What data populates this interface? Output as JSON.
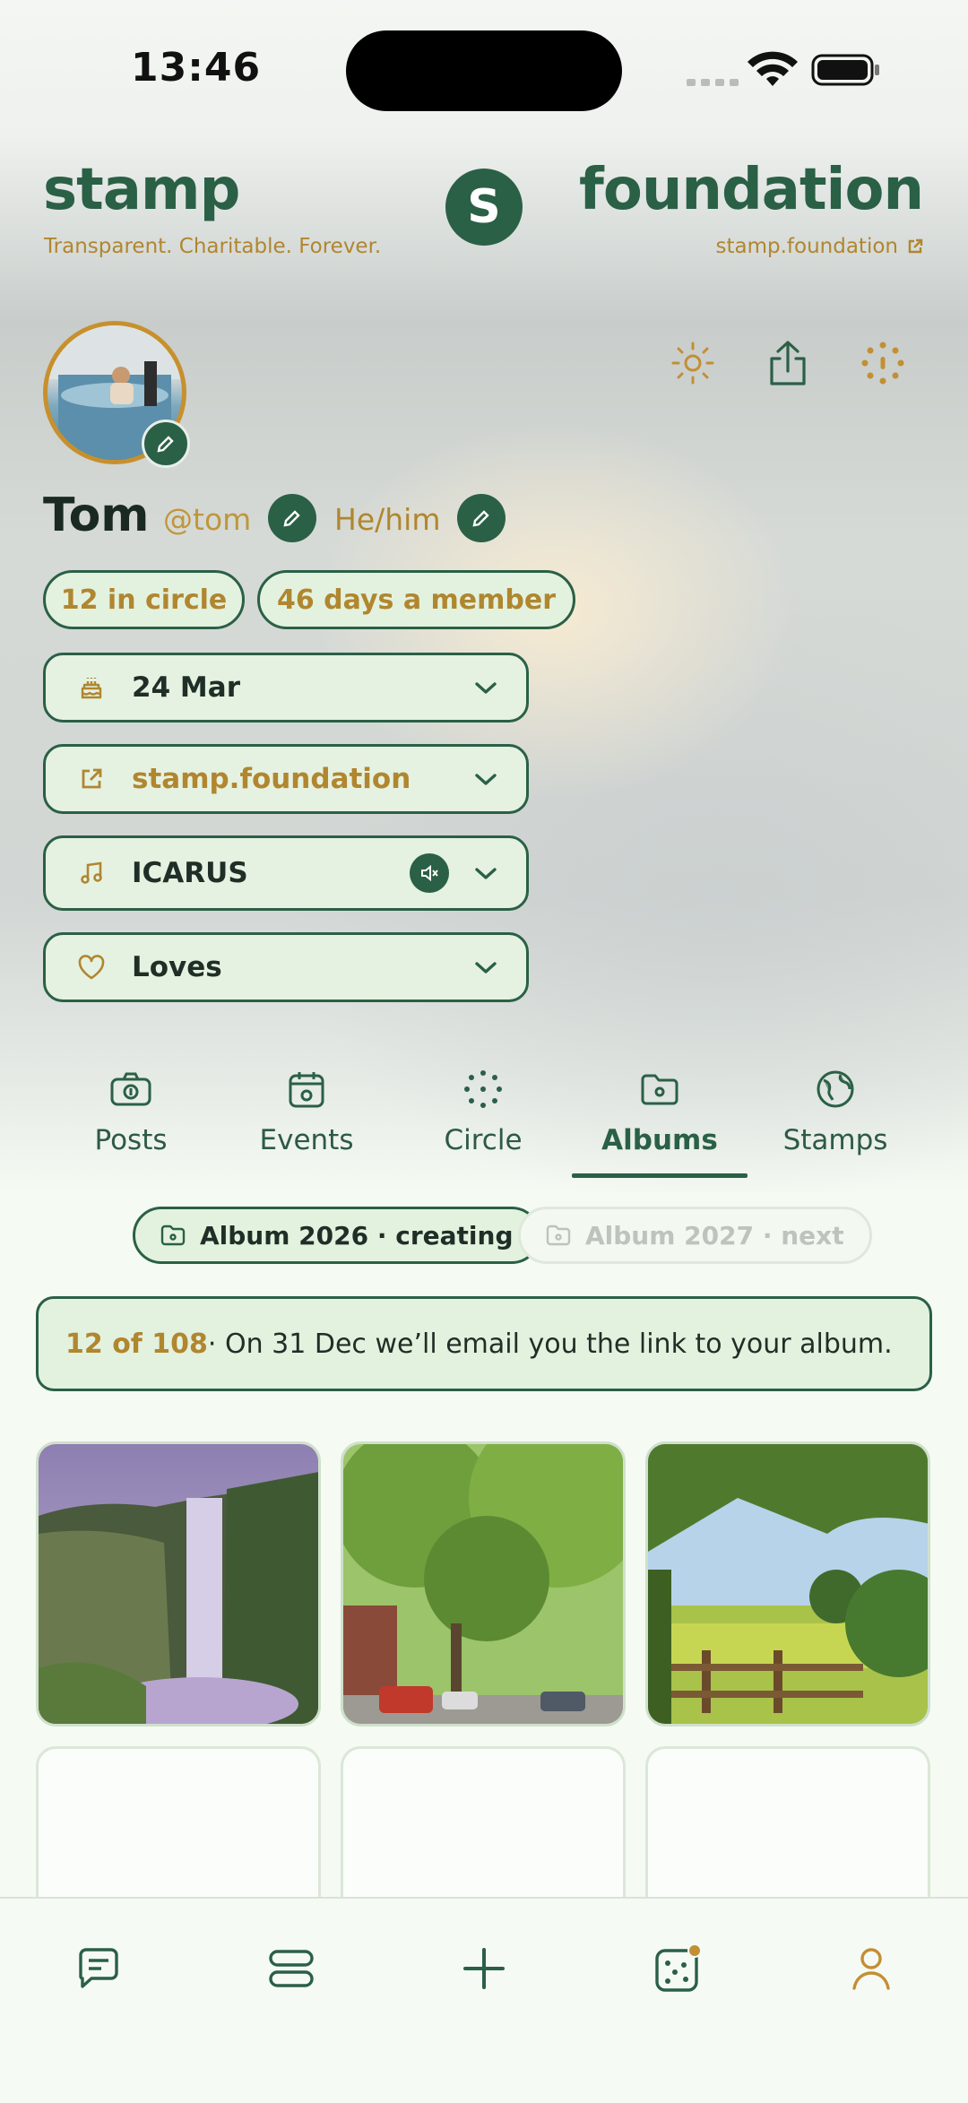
{
  "status_bar": {
    "time": "13:46"
  },
  "header": {
    "brand_left": "stamp",
    "brand_right": "foundation",
    "tagline": "Transparent. Charitable. Forever.",
    "site_link": "stamp.foundation",
    "logo_letter": "S"
  },
  "profile": {
    "name": "Tom",
    "handle": "@tom",
    "pronouns": "He/him",
    "stats": [
      "12 in circle",
      "46 days a member"
    ],
    "rows": [
      {
        "icon": "cake-icon",
        "label": "24 Mar"
      },
      {
        "icon": "external-link-icon",
        "label": "stamp.foundation"
      },
      {
        "icon": "music-note-icon",
        "label": "ICARUS"
      },
      {
        "icon": "heart-icon",
        "label": "Loves"
      }
    ]
  },
  "tabs": [
    {
      "label": "Posts",
      "icon": "camera-icon"
    },
    {
      "label": "Events",
      "icon": "calendar-icon"
    },
    {
      "label": "Circle",
      "icon": "dotted-circle-icon"
    },
    {
      "label": "Albums",
      "icon": "folder-icon",
      "active": true
    },
    {
      "label": "Stamps",
      "icon": "stamp-globe-icon"
    }
  ],
  "albums": {
    "chips": [
      "Album 2026 · creating",
      "Album 2027 · next"
    ],
    "notice_count": "12 of 108",
    "notice_text": " · On 31 Dec we’ll email you the link to your album."
  },
  "colors": {
    "accent": "#2a6046",
    "gold": "#b0862f",
    "pill_bg": "#e3f2df"
  }
}
